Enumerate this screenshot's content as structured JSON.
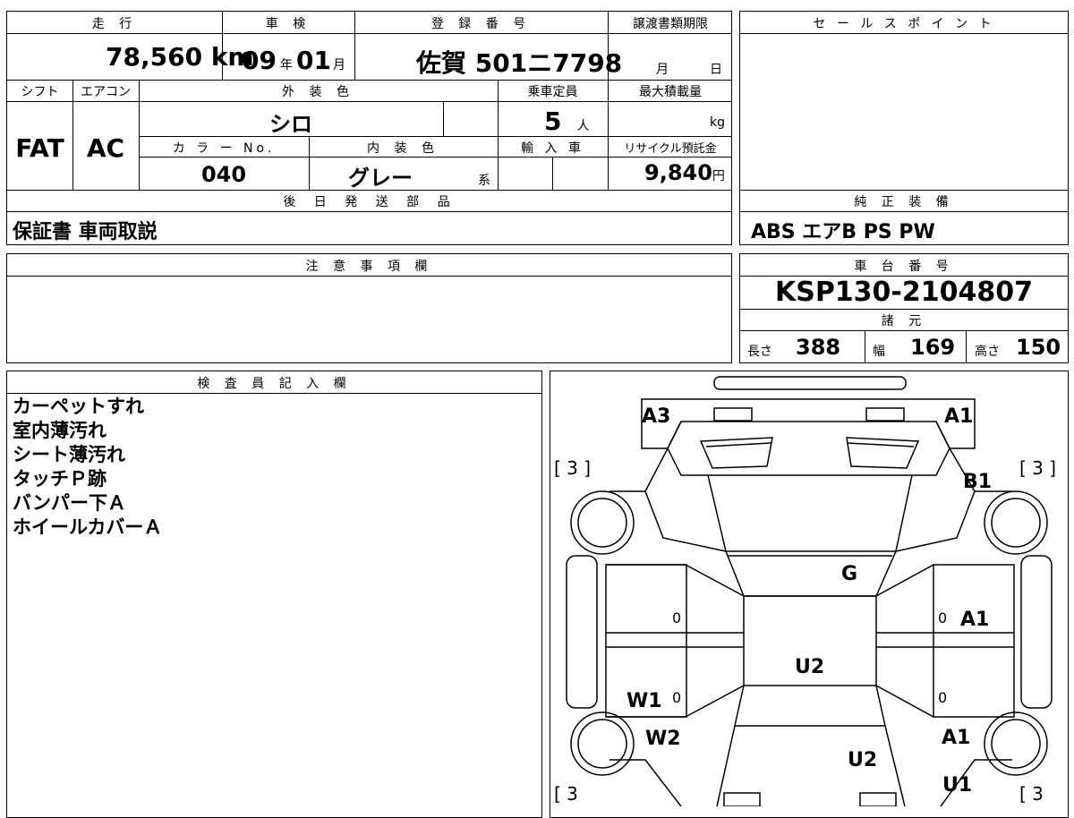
{
  "top_block": {
    "headers": {
      "mileage": "走 行",
      "shaken": "車 検",
      "registration": "登 録 番 号",
      "transfer_deadline": "譲渡書類期限",
      "shift": "シフト",
      "aircon": "エアコン",
      "exterior_color": "外 装 色",
      "capacity": "乗車定員",
      "max_load": "最大積載量",
      "color_no": "カ ラ ー No.",
      "interior_color": "内 装 色",
      "import": "輸 入 車",
      "recycle_fee": "リサイクル預託金",
      "later_parts": "後 日 発 送 部 品"
    },
    "mileage_value": "78,560",
    "mileage_unit": "km",
    "shaken_year": "09",
    "year_unit": "年",
    "shaken_month": "01",
    "month_unit": "月",
    "reg_prefecture": "佐賀",
    "reg_number": "501",
    "reg_kana": "ニ",
    "reg_serial": "7798",
    "transfer_month": "月",
    "transfer_day": "日",
    "shift_value": "FAT",
    "aircon_value": "AC",
    "exterior_color_value": "シロ",
    "capacity_value": "5",
    "capacity_unit": "人",
    "max_load_unit": "kg",
    "color_no_value": "040",
    "interior_color_value": "グレー",
    "interior_color_suffix": "系",
    "recycle_value": "9,840",
    "recycle_unit": "円",
    "later_parts_value": "保証書 車両取説"
  },
  "sales_point": {
    "header": "セ ー ル ス ポ イ ン ト",
    "equipment_header": "純 正 装 備",
    "equipment_value": "ABS エアB PS PW"
  },
  "notes": {
    "header": "注 意 事 項 欄"
  },
  "chassis": {
    "header": "車 台 番 号",
    "value": "KSP130-2104807",
    "specs_header": "諸 元",
    "length_label": "長さ",
    "length_value": "388",
    "width_label": "幅",
    "width_value": "169",
    "height_label": "高さ",
    "height_value": "150"
  },
  "inspector": {
    "header": "検 査 員 記 入 欄",
    "lines": [
      "カーペットすれ",
      "室内薄汚れ",
      "シート薄汚れ",
      "タッチＰ跡",
      "バンパー下Ａ",
      "ホイールカバーＡ"
    ]
  },
  "diagram": {
    "marks": {
      "a3_front_left": "A3",
      "a1_front_right": "A1",
      "b1_right_fender": "B1",
      "g_windshield": "G",
      "a1_right_door": "A1",
      "u2_roof": "U2",
      "w1_left_door": "W1",
      "w2_left_rear": "W2",
      "a1_right_rear": "A1",
      "u2_rear": "U2",
      "u1_right_rear": "U1"
    },
    "tire_tl": "[ 3 ]",
    "tire_tr": "[ 3 ]",
    "tire_bl": "[ 3",
    "tire_br": "[ 3",
    "zero": "0"
  }
}
